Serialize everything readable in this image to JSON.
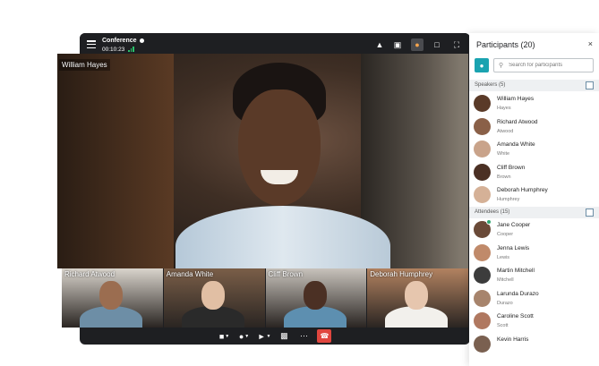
{
  "header": {
    "title": "Conference",
    "timer": "00:10:23"
  },
  "main_speaker": {
    "name": "William Hayes"
  },
  "thumbnails": [
    {
      "name": "Richard Atwood",
      "bg": "#d9d4cc",
      "skin": "#9b6d50",
      "shirt": "#6d8ea6"
    },
    {
      "name": "Amanda White",
      "bg": "#7a5e48",
      "skin": "#e1bfa4",
      "shirt": "#2a2a2a"
    },
    {
      "name": "Cliff Brown",
      "bg": "#c7c2bb",
      "skin": "#4b3024",
      "shirt": "#5d8fb0"
    },
    {
      "name": "Deborah Humphrey",
      "bg": "#b28260",
      "skin": "#e6c6ae",
      "shirt": "#f2f0ec"
    }
  ],
  "panel": {
    "title": "Participants (20)",
    "close": "×",
    "search_placeholder": "Search for participants",
    "speakers_title": "Speakers (5)",
    "attendees_title": "Attendees (15)",
    "speakers": [
      {
        "name": "William Hayes",
        "sub": "Hayes",
        "color": "#5a3a28"
      },
      {
        "name": "Richard Atwood",
        "sub": "Atwood",
        "color": "#8a6048"
      },
      {
        "name": "Amanda White",
        "sub": "White",
        "color": "#c9a38a"
      },
      {
        "name": "Cliff Brown",
        "sub": "Brown",
        "color": "#4b3024"
      },
      {
        "name": "Deborah Humphrey",
        "sub": "Humphrey",
        "color": "#d5b197"
      }
    ],
    "attendees": [
      {
        "name": "Jane Cooper",
        "sub": "Cooper",
        "color": "#6a4a38"
      },
      {
        "name": "Jenna Lewis",
        "sub": "Lewis",
        "color": "#c08a6a"
      },
      {
        "name": "Martin Mitchell",
        "sub": "Mitchell",
        "color": "#3c3c3c"
      },
      {
        "name": "Larunda Durazo",
        "sub": "Durazo",
        "color": "#a7846c"
      },
      {
        "name": "Caroline Scott",
        "sub": "Scott",
        "color": "#b07860"
      },
      {
        "name": "Kevin Harris",
        "sub": "",
        "color": "#7a6050"
      }
    ]
  },
  "colors": {
    "accent": "#1aa3b0",
    "end_call": "#e0463e",
    "active_icon": "#f4a34c"
  }
}
